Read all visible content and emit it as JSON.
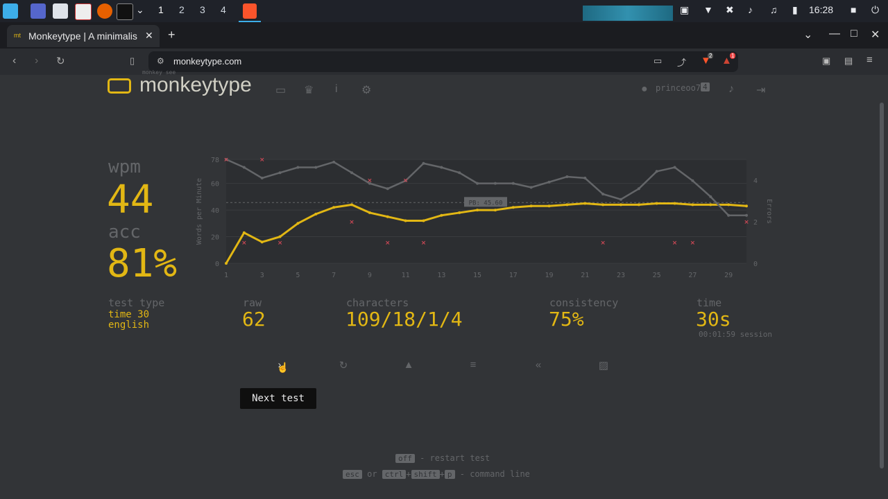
{
  "taskbar": {
    "workspaces": [
      "1",
      "2",
      "3",
      "4"
    ],
    "clock": "16:28"
  },
  "browser": {
    "tab_title": "Monkeytype | A minimalis",
    "url": "monkeytype.com",
    "shield_badge": "2",
    "alert_badge": "1"
  },
  "site": {
    "logo_small": "monkey see",
    "logo_text": "monkeytype",
    "username": "princeoo7",
    "level": "4"
  },
  "results": {
    "wpm_label": "wpm",
    "wpm_value": "44",
    "acc_label": "acc",
    "acc_value": "81%",
    "test_type_label": "test type",
    "test_type_line1": "time 30",
    "test_type_line2": "english",
    "raw_label": "raw",
    "raw_value": "62",
    "characters_label": "characters",
    "characters_value": "109/18/1/4",
    "consistency_label": "consistency",
    "consistency_value": "75%",
    "time_label": "time",
    "time_value": "30s",
    "session_value": "00:01:59 session",
    "tooltip": "Next test"
  },
  "footer": {
    "key1": "off",
    "line1": "- restart test",
    "key_esc": "esc",
    "or": "or",
    "key_ctrl": "ctrl",
    "key_shift": "shift",
    "key_p": "p",
    "plus": "+",
    "line2": "- command line"
  },
  "chart_data": {
    "type": "line",
    "ylabel": "Words per Minute",
    "y2label": "Errors",
    "pb_label": "PB: 45.60",
    "pb_value": 45.6,
    "ylim": [
      0,
      78
    ],
    "y2lim": [
      0,
      5
    ],
    "yticks": [
      "0",
      "20",
      "40",
      "60",
      "78"
    ],
    "y2ticks": [
      "0",
      "2",
      "4"
    ],
    "x": [
      1,
      2,
      3,
      4,
      5,
      6,
      7,
      8,
      9,
      10,
      11,
      12,
      13,
      14,
      15,
      16,
      17,
      18,
      19,
      20,
      21,
      22,
      23,
      24,
      25,
      26,
      27,
      28,
      29,
      30
    ],
    "xticks": [
      "1",
      "3",
      "5",
      "7",
      "9",
      "11",
      "13",
      "15",
      "17",
      "19",
      "21",
      "23",
      "25",
      "27",
      "29"
    ],
    "series": [
      {
        "values": [
          0,
          23,
          16,
          20,
          30,
          37,
          42,
          44,
          38,
          35,
          32,
          32,
          36,
          38,
          40,
          40,
          42,
          43,
          43,
          44,
          45,
          44,
          44,
          44,
          45,
          45,
          44,
          44,
          44,
          43
        ]
      },
      {
        "values": [
          78,
          72,
          64,
          68,
          72,
          72,
          76,
          68,
          60,
          56,
          62,
          75,
          72,
          68,
          60,
          60,
          60,
          57,
          61,
          65,
          64,
          52,
          48,
          56,
          69,
          72,
          62,
          50,
          36,
          36
        ]
      }
    ],
    "errors": [
      {
        "x": 1,
        "e": 5
      },
      {
        "x": 2,
        "e": 1
      },
      {
        "x": 3,
        "e": 5
      },
      {
        "x": 4,
        "e": 1
      },
      {
        "x": 8,
        "e": 2
      },
      {
        "x": 9,
        "e": 4
      },
      {
        "x": 10,
        "e": 1
      },
      {
        "x": 11,
        "e": 4
      },
      {
        "x": 12,
        "e": 1
      },
      {
        "x": 22,
        "e": 1
      },
      {
        "x": 26,
        "e": 1
      },
      {
        "x": 27,
        "e": 1
      },
      {
        "x": 30,
        "e": 2
      }
    ]
  }
}
